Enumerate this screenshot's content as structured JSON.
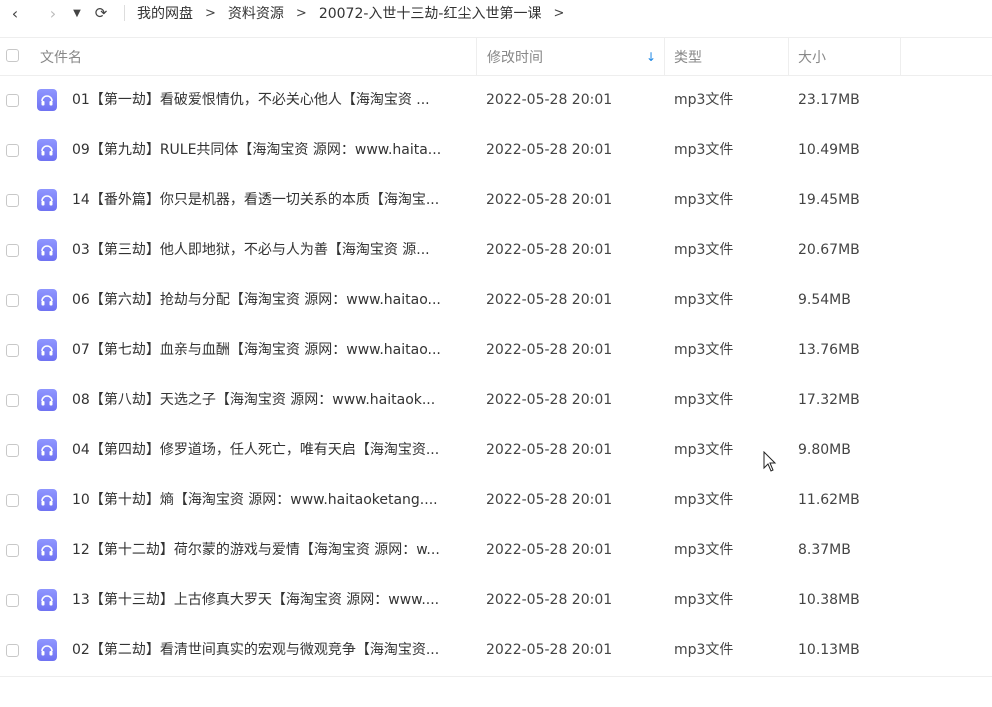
{
  "toolbar": {
    "back_icon": "‹",
    "forward_icon": "›",
    "history_icon": "▼",
    "refresh_icon": "⟳"
  },
  "breadcrumb": {
    "items": [
      "我的网盘",
      "资料资源",
      "20072-入世十三劫-红尘入世第一课"
    ],
    "separator": ">"
  },
  "table": {
    "headers": {
      "name": "文件名",
      "mtime": "修改时间",
      "type": "类型",
      "size": "大小"
    },
    "sort_icon": "↓",
    "rows": [
      {
        "name": "01【第一劫】看破爱恨情仇，不必关心他人【海淘宝资 ...",
        "mtime": "2022-05-28 20:01",
        "type": "mp3文件",
        "size": "23.17MB"
      },
      {
        "name": "09【第九劫】RULE共同体【海淘宝资 源网：www.haita...",
        "mtime": "2022-05-28 20:01",
        "type": "mp3文件",
        "size": "10.49MB"
      },
      {
        "name": "14【番外篇】你只是机器，看透一切关系的本质【海淘宝...",
        "mtime": "2022-05-28 20:01",
        "type": "mp3文件",
        "size": "19.45MB"
      },
      {
        "name": "03【第三劫】他人即地狱，不必与人为善【海淘宝资 源...",
        "mtime": "2022-05-28 20:01",
        "type": "mp3文件",
        "size": "20.67MB"
      },
      {
        "name": "06【第六劫】抢劫与分配【海淘宝资 源网：www.haitao...",
        "mtime": "2022-05-28 20:01",
        "type": "mp3文件",
        "size": "9.54MB"
      },
      {
        "name": "07【第七劫】血亲与血酬【海淘宝资 源网：www.haitao...",
        "mtime": "2022-05-28 20:01",
        "type": "mp3文件",
        "size": "13.76MB"
      },
      {
        "name": "08【第八劫】天选之子【海淘宝资 源网：www.haitaok...",
        "mtime": "2022-05-28 20:01",
        "type": "mp3文件",
        "size": "17.32MB"
      },
      {
        "name": "04【第四劫】修罗道场，任人死亡，唯有天启【海淘宝资...",
        "mtime": "2022-05-28 20:01",
        "type": "mp3文件",
        "size": "9.80MB"
      },
      {
        "name": "10【第十劫】熵【海淘宝资 源网：www.haitaoketang....",
        "mtime": "2022-05-28 20:01",
        "type": "mp3文件",
        "size": "11.62MB"
      },
      {
        "name": "12【第十二劫】荷尔蒙的游戏与爱情【海淘宝资 源网：w...",
        "mtime": "2022-05-28 20:01",
        "type": "mp3文件",
        "size": "8.37MB"
      },
      {
        "name": "13【第十三劫】上古修真大罗天【海淘宝资 源网：www....",
        "mtime": "2022-05-28 20:01",
        "type": "mp3文件",
        "size": "10.38MB"
      },
      {
        "name": "02【第二劫】看清世间真实的宏观与微观竞争【海淘宝资...",
        "mtime": "2022-05-28 20:01",
        "type": "mp3文件",
        "size": "10.13MB"
      }
    ]
  },
  "colors": {
    "file_icon": "#7478f5",
    "sort_accent": "#1e88e5"
  }
}
